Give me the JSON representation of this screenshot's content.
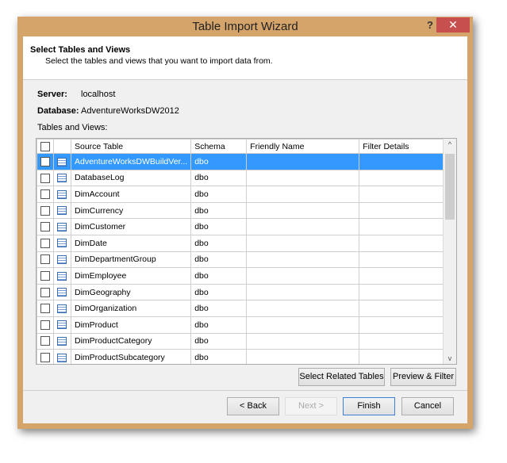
{
  "window": {
    "title": "Table Import Wizard",
    "help": "?",
    "close": "✕"
  },
  "header": {
    "title": "Select Tables and Views",
    "subtitle": "Select the tables and views that you want to import data from."
  },
  "server": {
    "label": "Server:",
    "value": "localhost"
  },
  "database": {
    "label": "Database:",
    "value": "AdventureWorksDW2012"
  },
  "list_label": "Tables and Views:",
  "columns": [
    "Source Table",
    "Schema",
    "Friendly Name",
    "Filter Details"
  ],
  "rows": [
    {
      "source": "AdventureWorksDWBuildVer...",
      "schema": "dbo",
      "friendly": "",
      "filter": "",
      "selected": true
    },
    {
      "source": "DatabaseLog",
      "schema": "dbo",
      "friendly": "",
      "filter": ""
    },
    {
      "source": "DimAccount",
      "schema": "dbo",
      "friendly": "",
      "filter": ""
    },
    {
      "source": "DimCurrency",
      "schema": "dbo",
      "friendly": "",
      "filter": ""
    },
    {
      "source": "DimCustomer",
      "schema": "dbo",
      "friendly": "",
      "filter": ""
    },
    {
      "source": "DimDate",
      "schema": "dbo",
      "friendly": "",
      "filter": ""
    },
    {
      "source": "DimDepartmentGroup",
      "schema": "dbo",
      "friendly": "",
      "filter": ""
    },
    {
      "source": "DimEmployee",
      "schema": "dbo",
      "friendly": "",
      "filter": ""
    },
    {
      "source": "DimGeography",
      "schema": "dbo",
      "friendly": "",
      "filter": ""
    },
    {
      "source": "DimOrganization",
      "schema": "dbo",
      "friendly": "",
      "filter": ""
    },
    {
      "source": "DimProduct",
      "schema": "dbo",
      "friendly": "",
      "filter": ""
    },
    {
      "source": "DimProductCategory",
      "schema": "dbo",
      "friendly": "",
      "filter": ""
    },
    {
      "source": "DimProductSubcategory",
      "schema": "dbo",
      "friendly": "",
      "filter": ""
    }
  ],
  "buttons": {
    "select_related": "Select Related Tables",
    "preview": "Preview & Filter",
    "back": "< Back",
    "next": "Next >",
    "finish": "Finish",
    "cancel": "Cancel"
  }
}
